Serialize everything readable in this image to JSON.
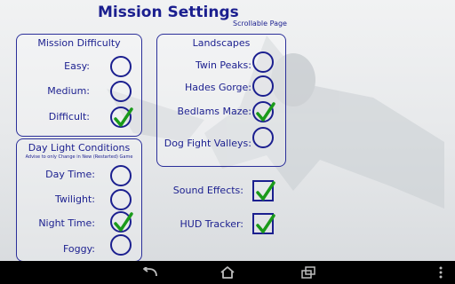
{
  "header": {
    "title": "Mission Settings",
    "subtitle": "Scrollable Page"
  },
  "mission_difficulty": {
    "title": "Mission Difficulty",
    "options": [
      {
        "label": "Easy:",
        "checked": false
      },
      {
        "label": "Medium:",
        "checked": false
      },
      {
        "label": "Difficult:",
        "checked": true
      }
    ]
  },
  "landscapes": {
    "title": "Landscapes",
    "options": [
      {
        "label": "Twin Peaks:",
        "checked": false
      },
      {
        "label": "Hades Gorge:",
        "checked": false
      },
      {
        "label": "Bedlams Maze:",
        "checked": true
      },
      {
        "label": "Dog Fight Valleys:",
        "checked": false
      }
    ]
  },
  "daylight": {
    "title": "Day Light Conditions",
    "note": "Advise to only Change in New (Restarted) Game",
    "options": [
      {
        "label": "Day Time:",
        "checked": false
      },
      {
        "label": "Twilight:",
        "checked": false
      },
      {
        "label": "Night Time:",
        "checked": true
      },
      {
        "label": "Foggy:",
        "checked": false
      }
    ]
  },
  "toggles": [
    {
      "label": "Sound Effects:",
      "checked": true
    },
    {
      "label": "HUD Tracker:",
      "checked": true
    }
  ],
  "colors": {
    "text": "#1b1f8f",
    "check": "#1a9a1a",
    "navbar": "#000000"
  },
  "navbar": {
    "icons": [
      "back-icon",
      "home-icon",
      "recents-icon",
      "menu-icon"
    ]
  }
}
